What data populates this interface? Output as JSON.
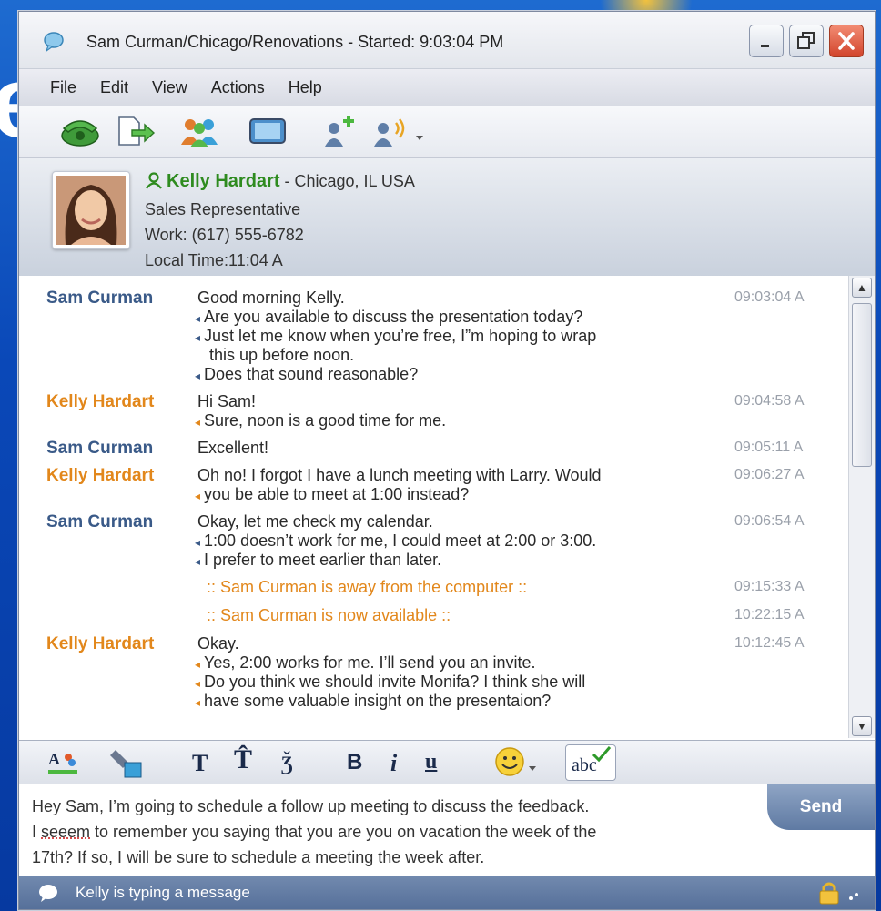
{
  "window": {
    "title": "Sam Curman/Chicago/Renovations - Started: 9:03:04 PM"
  },
  "menu": [
    "File",
    "Edit",
    "View",
    "Actions",
    "Help"
  ],
  "toolbar": {
    "icons": [
      "phone-icon",
      "send-file-icon",
      "invite-group-icon",
      "screen-share-icon",
      "add-contact-icon",
      "audio-icon"
    ]
  },
  "contact": {
    "name": "Kelly Hardart",
    "location": "- Chicago, IL USA",
    "role": "Sales Representative",
    "work": "Work: (617) 555-6782",
    "local_time": "Local Time:11:04 A"
  },
  "chat": {
    "messages": [
      {
        "sender": "Sam Curman",
        "color": "#3a5a88",
        "time": "09:03:04 A",
        "lines": [
          "Good morning Kelly.",
          "Are you available to discuss the presentation today?",
          "Just let me know when you’re free, I”m hoping to wrap",
          "this up before noon.",
          "Does that sound reasonable?"
        ]
      },
      {
        "sender": "Kelly Hardart",
        "color": "#e2871b",
        "time": "09:04:58 A",
        "lines": [
          "Hi Sam!",
          "Sure, noon is a good time for me."
        ]
      },
      {
        "sender": "Sam Curman",
        "color": "#3a5a88",
        "time": "09:05:11 A",
        "lines": [
          "Excellent!"
        ]
      },
      {
        "sender": "Kelly Hardart",
        "color": "#e2871b",
        "time": "09:06:27 A",
        "lines": [
          "Oh no! I forgot I have a lunch meeting with Larry. Would",
          "you be able to meet at 1:00 instead?"
        ]
      },
      {
        "sender": "Sam Curman",
        "color": "#3a5a88",
        "time": "09:06:54 A",
        "lines": [
          "Okay, let me check my calendar.",
          "1:00 doesn’t work for me, I could meet at 2:00 or 3:00.",
          "I prefer to meet earlier than later."
        ]
      },
      {
        "system": ":: Sam Curman is away from the computer ::",
        "time": "09:15:33 A"
      },
      {
        "system": ":: Sam Curman is now available ::",
        "time": "10:22:15 A"
      },
      {
        "sender": "Kelly Hardart",
        "color": "#e2871b",
        "time": "10:12:45 A",
        "lines": [
          "Okay.",
          "Yes, 2:00 works for me. I’ll send you an invite.",
          "Do you think we should invite Monifa? I think she will",
          "have some valuable insight on the presentaion?"
        ]
      }
    ]
  },
  "format_toolbar": {
    "icons": [
      "font-color-icon",
      "background-color-icon",
      "normal-text-icon",
      "increase-font-icon",
      "decrease-font-icon",
      "bold-icon",
      "italic-icon",
      "underline-icon",
      "emoticon-icon",
      "spell-check-icon"
    ],
    "labels": {
      "t1": "T",
      "t2": "T̂",
      "t3": "Ǯ",
      "bold": "B",
      "italic": "i",
      "underline": "u",
      "spell": "abc",
      "font": "A"
    }
  },
  "compose": {
    "line1": "Hey Sam, I’m going to schedule a follow up meeting to discuss the feedback.",
    "line2_pre": "I ",
    "line2_misspelled": "seeem",
    "line2_post": " to remember you saying that you are you on vacation the week of the",
    "line3": "17th? If so, I will be sure to schedule a meeting the week after.",
    "send_label": "Send"
  },
  "status": {
    "text": "Kelly is typing a message"
  },
  "background": {
    "letter": "e"
  }
}
